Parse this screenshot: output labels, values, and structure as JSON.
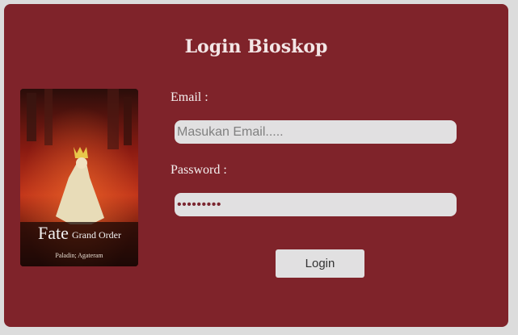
{
  "page": {
    "title": "Login Bioskop"
  },
  "poster": {
    "brand_line1": "Fate",
    "brand_line2": "Grand Order",
    "subtitle": "Paladin; Agateram"
  },
  "form": {
    "email_label": "Email :",
    "email_placeholder": "Masukan Email.....",
    "password_label": "Password :",
    "password_value": "•••••••••",
    "login_label": "Login"
  },
  "colors": {
    "card_bg": "#7f232a",
    "page_bg": "#dcdcdc",
    "field_bg": "#e1e0e1"
  }
}
